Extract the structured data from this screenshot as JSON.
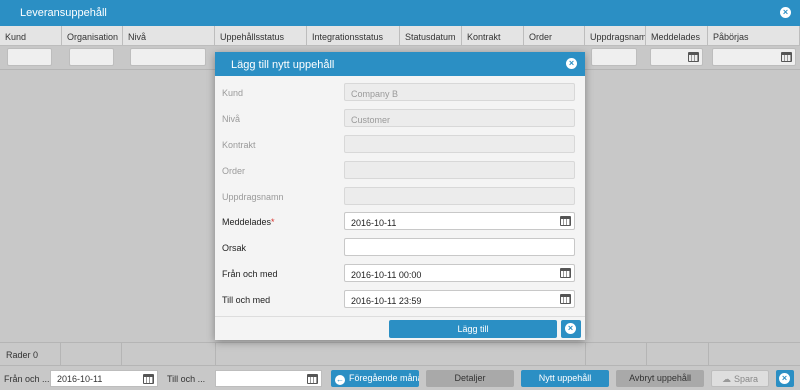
{
  "window": {
    "title": "Leveransuppehåll"
  },
  "grid": {
    "columns": [
      "Kund",
      "Organisation",
      "Nivå",
      "Uppehållsstatus",
      "Integrationsstatus",
      "Statusdatum",
      "Kontrakt",
      "Order",
      "Uppdragsnamn",
      "Meddelades",
      "Påbörjas"
    ]
  },
  "status": {
    "rows_label": "Rader 0"
  },
  "footer": {
    "from_label": "Från och ...",
    "from_value": "2016-10-11",
    "to_label": "Till och ...",
    "to_value": "",
    "prev_month_label": "Föregående månad",
    "details_label": "Detaljer",
    "new_label": "Nytt uppehåll",
    "cancel_label": "Avbryt uppehåll",
    "save_label": "Spara"
  },
  "modal": {
    "title": "Lägg till nytt uppehåll",
    "fields": [
      {
        "label": "Kund",
        "value": "Company B",
        "enabled": false
      },
      {
        "label": "Nivå",
        "value": "Customer",
        "enabled": false
      },
      {
        "label": "Kontrakt",
        "value": "",
        "enabled": false
      },
      {
        "label": "Order",
        "value": "",
        "enabled": false
      },
      {
        "label": "Uppdragsnamn",
        "value": "",
        "enabled": false
      },
      {
        "label": "Meddelades",
        "value": "2016-10-11",
        "enabled": true,
        "required_mark": "*",
        "icon": "calendar-icon"
      },
      {
        "label": "Orsak",
        "value": "",
        "enabled": true
      },
      {
        "label": "Från och med",
        "value": "2016-10-11 00:00",
        "enabled": true,
        "icon": "calendar-icon"
      },
      {
        "label": "Till och med",
        "value": "2016-10-11 23:59",
        "enabled": true,
        "icon": "calendar-icon"
      }
    ],
    "add_label": "Lägg till"
  },
  "colors": {
    "accent": "#2b8fc4",
    "background": "#c8c8c8",
    "required": "#d9302a"
  }
}
